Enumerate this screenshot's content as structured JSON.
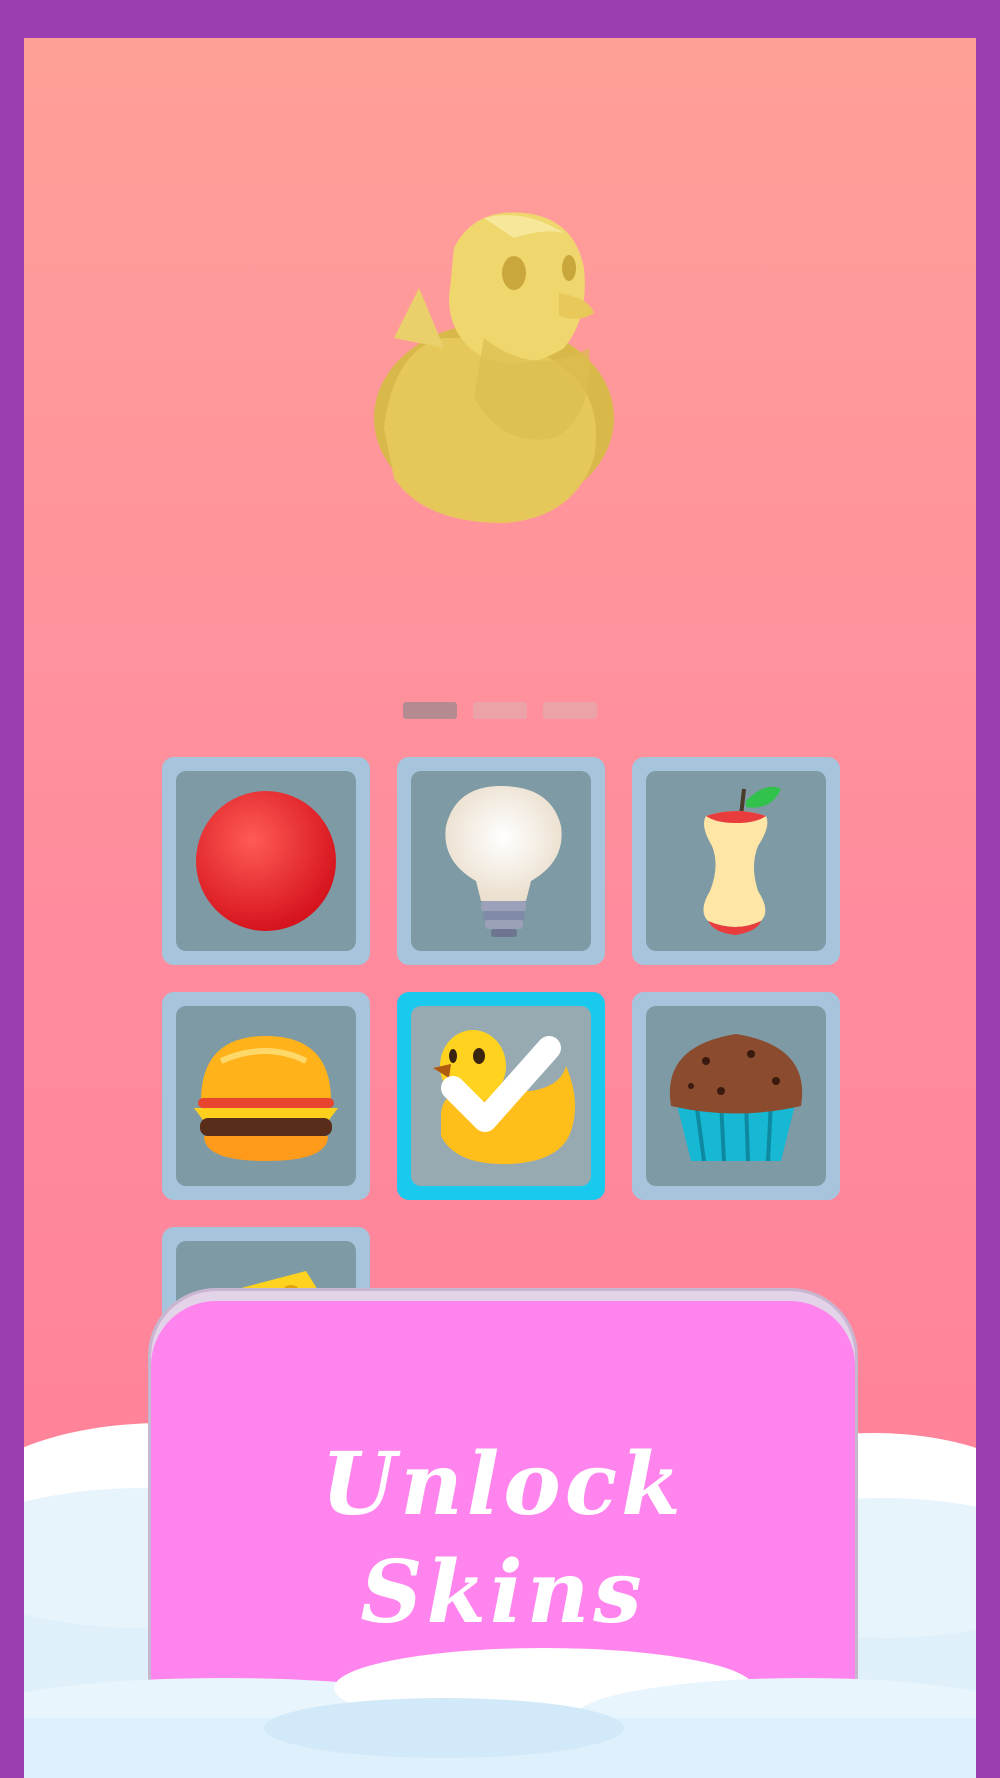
{
  "hero": {
    "skin": "rubber-duck",
    "color": "#e8c95a"
  },
  "pager": {
    "pages": 3,
    "active_index": 0
  },
  "skins": [
    {
      "name": "red-ball",
      "icon": "red-ball-icon",
      "selected": false
    },
    {
      "name": "light-bulb",
      "icon": "light-bulb-icon",
      "selected": false
    },
    {
      "name": "apple-core",
      "icon": "apple-core-icon",
      "selected": false
    },
    {
      "name": "burger",
      "icon": "burger-icon",
      "selected": false
    },
    {
      "name": "rubber-duck",
      "icon": "rubber-duck-icon",
      "selected": true
    },
    {
      "name": "muffin",
      "icon": "muffin-icon",
      "selected": false
    },
    {
      "name": "cheese",
      "icon": "cheese-icon",
      "selected": false
    }
  ],
  "unlock_button": {
    "line1": "Unlock",
    "line2": "Skins"
  },
  "colors": {
    "frame": "#9b3fb0",
    "background_top": "#ffa098",
    "background_bottom": "#ff7f97",
    "tile_border": "#a6c4dc",
    "tile_selected_border": "#19c9ee",
    "tile_fill": "#7e9aa4",
    "button": "#ff84ee"
  }
}
